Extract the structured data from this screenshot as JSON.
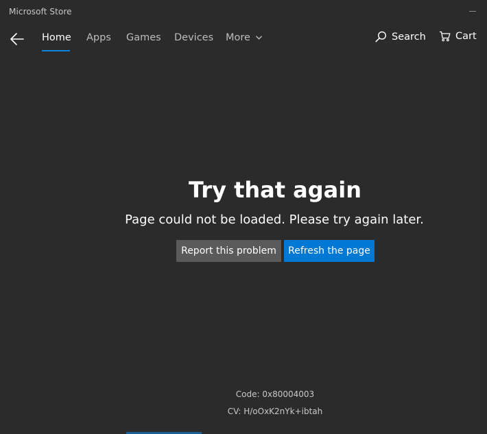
{
  "window": {
    "title": "Microsoft Store"
  },
  "nav": {
    "items": [
      {
        "label": "Home",
        "active": true
      },
      {
        "label": "Apps",
        "active": false
      },
      {
        "label": "Games",
        "active": false
      },
      {
        "label": "Devices",
        "active": false
      },
      {
        "label": "More",
        "active": false
      }
    ],
    "search_label": "Search",
    "cart_label": "Cart"
  },
  "error": {
    "title": "Try that again",
    "message": "Page could not be loaded. Please try again later.",
    "report_label": "Report this problem",
    "refresh_label": "Refresh the page",
    "code": "Code: 0x80004003",
    "cv": "CV: H/oOxK2nYk+ibtah"
  },
  "colors": {
    "background": "#2b2b2b",
    "accent": "#0078d4",
    "secondary_button": "#5a5a5a"
  },
  "icons": {
    "back": "back-arrow-icon",
    "more": "chevron-down-icon",
    "search": "search-icon",
    "cart": "cart-icon",
    "minimize": "minimize-icon"
  }
}
